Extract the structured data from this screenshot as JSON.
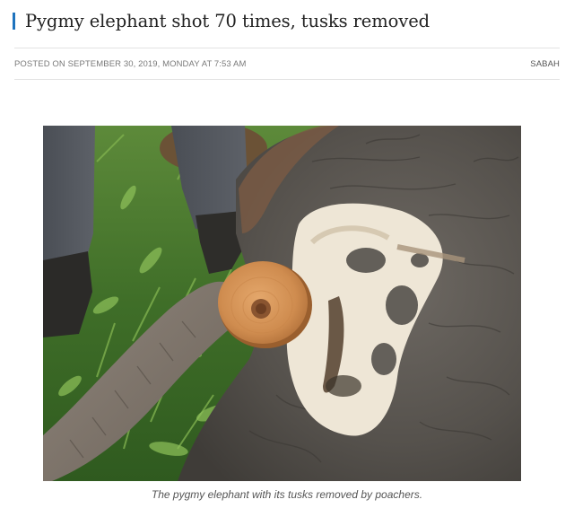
{
  "article": {
    "title": "Pygmy elephant shot 70 times, tusks removed",
    "posted": "POSTED ON SEPTEMBER 30, 2019, MONDAY AT 7:53 AM",
    "category": "SABAH",
    "caption": "The pygmy elephant with its tusks removed by poachers."
  },
  "colors": {
    "accent": "#1e73be"
  }
}
